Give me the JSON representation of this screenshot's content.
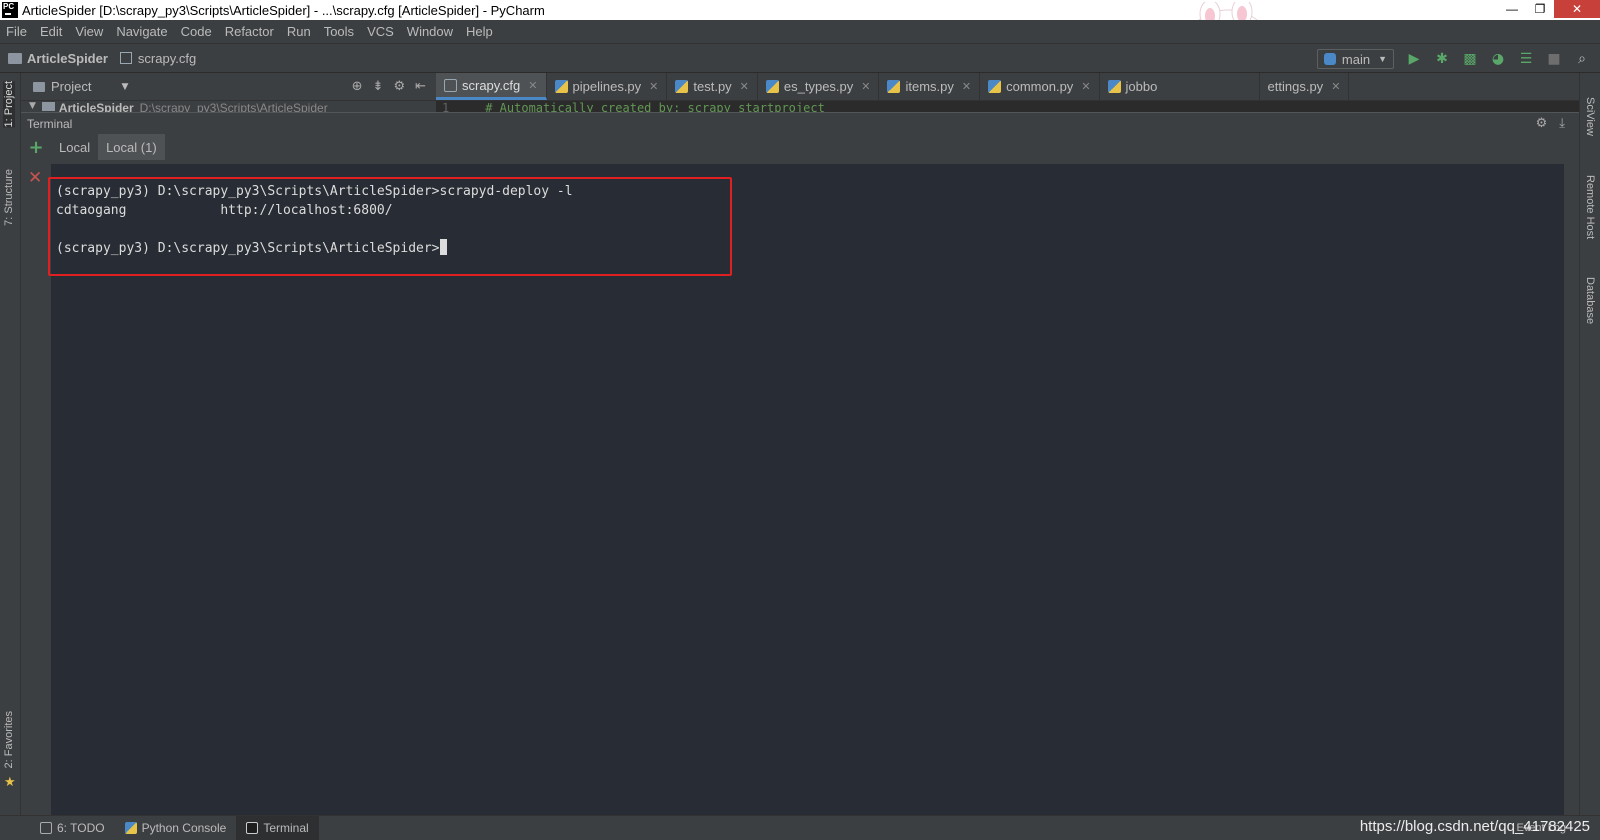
{
  "window": {
    "title": "ArticleSpider [D:\\scrapy_py3\\Scripts\\ArticleSpider] - ...\\scrapy.cfg [ArticleSpider] - PyCharm",
    "app_icon_text": "PC",
    "minimize": "—",
    "maximize": "❐",
    "close": "✕"
  },
  "menu": [
    "File",
    "Edit",
    "View",
    "Navigate",
    "Code",
    "Refactor",
    "Run",
    "Tools",
    "VCS",
    "Window",
    "Help"
  ],
  "navbar": {
    "project": "ArticleSpider",
    "file": "scrapy.cfg",
    "run_config": "main"
  },
  "left_tool_tabs": {
    "project": "1: Project",
    "structure": "7: Structure",
    "favorites": "2: Favorites"
  },
  "right_tool_tabs": {
    "sciview": "SciView",
    "remote_host": "Remote Host",
    "database": "Database"
  },
  "project_pane": {
    "label": "Project",
    "root_name": "ArticleSpider",
    "root_path": "D:\\scrapy_py3\\Scripts\\ArticleSpider"
  },
  "editor_tabs": [
    {
      "label": "scrapy.cfg",
      "active": true
    },
    {
      "label": "pipelines.py",
      "active": false
    },
    {
      "label": "test.py",
      "active": false
    },
    {
      "label": "es_types.py",
      "active": false
    },
    {
      "label": "items.py",
      "active": false
    },
    {
      "label": "common.py",
      "active": false
    },
    {
      "label": "jobbo",
      "active": false
    },
    {
      "label": "ettings.py",
      "active": false
    }
  ],
  "editor_peek": {
    "line_number": "1",
    "code": "# Automatically created by: scrapy startproject"
  },
  "terminal": {
    "title": "Terminal",
    "tabs": [
      {
        "label": "Local",
        "active": false
      },
      {
        "label": "Local (1)",
        "active": true
      }
    ],
    "lines": [
      "(scrapy_py3) D:\\scrapy_py3\\Scripts\\ArticleSpider>scrapyd-deploy -l",
      "cdtaogang            http://localhost:6800/",
      "",
      "(scrapy_py3) D:\\scrapy_py3\\Scripts\\ArticleSpider>"
    ]
  },
  "statusbar": {
    "todo": "6: TODO",
    "python_console": "Python Console",
    "terminal": "Terminal",
    "event_log": "Event Log",
    "watermark": "https://blog.csdn.net/qq_41782425"
  },
  "colors": {
    "highlight_box": "#e02020",
    "accent": "#4a88c7",
    "run_green": "#59a869"
  }
}
